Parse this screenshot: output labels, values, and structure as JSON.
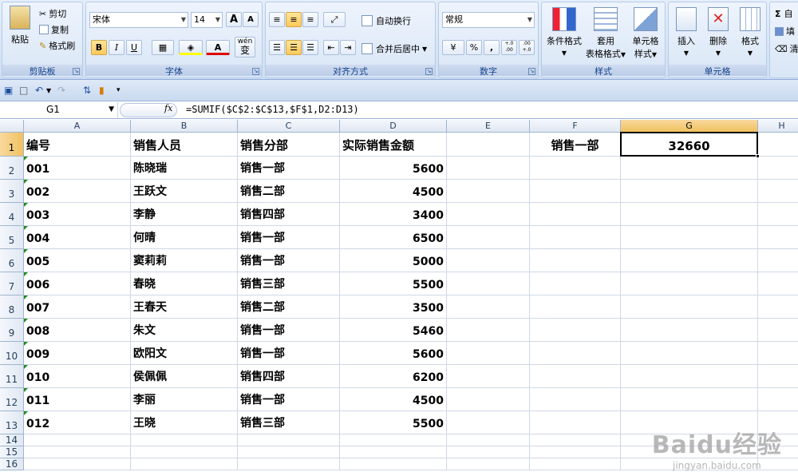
{
  "ribbon": {
    "clipboard": {
      "label": "剪贴板",
      "paste": "粘贴",
      "cut": "剪切",
      "copy": "复制",
      "format_painter": "格式刷"
    },
    "font": {
      "label": "字体",
      "font_name": "宋体",
      "font_size": "14",
      "bold": "B",
      "italic": "I",
      "underline": "U",
      "grow": "A",
      "shrink": "A",
      "wen": "wén",
      "wen_char": "变"
    },
    "alignment": {
      "label": "对齐方式",
      "wrap_text": "自动换行",
      "merge_center": "合并后居中"
    },
    "number": {
      "label": "数字",
      "format": "常规",
      "percent": "%",
      "comma": ",",
      "inc_decimal": "+.0 .00",
      "dec_decimal": ".00 +.0"
    },
    "styles": {
      "label": "样式",
      "conditional": "条件格式",
      "table_format": "套用",
      "table_format_2": "表格格式",
      "cell_styles": "单元格",
      "cell_styles_2": "样式"
    },
    "cells": {
      "label": "单元格",
      "insert": "插入",
      "delete": "删除",
      "format": "格式"
    },
    "editing": {
      "sum": "Σ",
      "sum_label": "自",
      "fill_label": "填",
      "clear_label": "清"
    }
  },
  "formula_bar": {
    "name_box": "G1",
    "fx": "fx",
    "formula": "=SUMIF($C$2:$C$13,$F$1,D2:D13)"
  },
  "columns": [
    "A",
    "B",
    "C",
    "D",
    "E",
    "F",
    "G",
    "H"
  ],
  "rows": [
    "1",
    "2",
    "3",
    "4",
    "5",
    "6",
    "7",
    "8",
    "9",
    "10",
    "11",
    "12",
    "13",
    "14",
    "15",
    "16"
  ],
  "header_row": {
    "a": "编号",
    "b": "销售人员",
    "c": "销售分部",
    "d": "实际销售金额",
    "f": "销售一部",
    "g": "32660"
  },
  "data_rows": [
    {
      "a": "001",
      "b": "陈晓瑞",
      "c": "销售一部",
      "d": "5600"
    },
    {
      "a": "002",
      "b": "王跃文",
      "c": "销售二部",
      "d": "4500"
    },
    {
      "a": "003",
      "b": "李静",
      "c": "销售四部",
      "d": "3400"
    },
    {
      "a": "004",
      "b": "何晴",
      "c": "销售一部",
      "d": "6500"
    },
    {
      "a": "005",
      "b": "窦莉莉",
      "c": "销售一部",
      "d": "5000"
    },
    {
      "a": "006",
      "b": "春晓",
      "c": "销售三部",
      "d": "5500"
    },
    {
      "a": "007",
      "b": "王春天",
      "c": "销售二部",
      "d": "3500"
    },
    {
      "a": "008",
      "b": "朱文",
      "c": "销售一部",
      "d": "5460"
    },
    {
      "a": "009",
      "b": "欧阳文",
      "c": "销售一部",
      "d": "5600"
    },
    {
      "a": "010",
      "b": "侯佩佩",
      "c": "销售四部",
      "d": "6200"
    },
    {
      "a": "011",
      "b": "李丽",
      "c": "销售一部",
      "d": "4500"
    },
    {
      "a": "012",
      "b": "王晓",
      "c": "销售三部",
      "d": "5500"
    }
  ],
  "watermark": {
    "brand": "Baidu经验",
    "url": "jingyan.baidu.com"
  }
}
